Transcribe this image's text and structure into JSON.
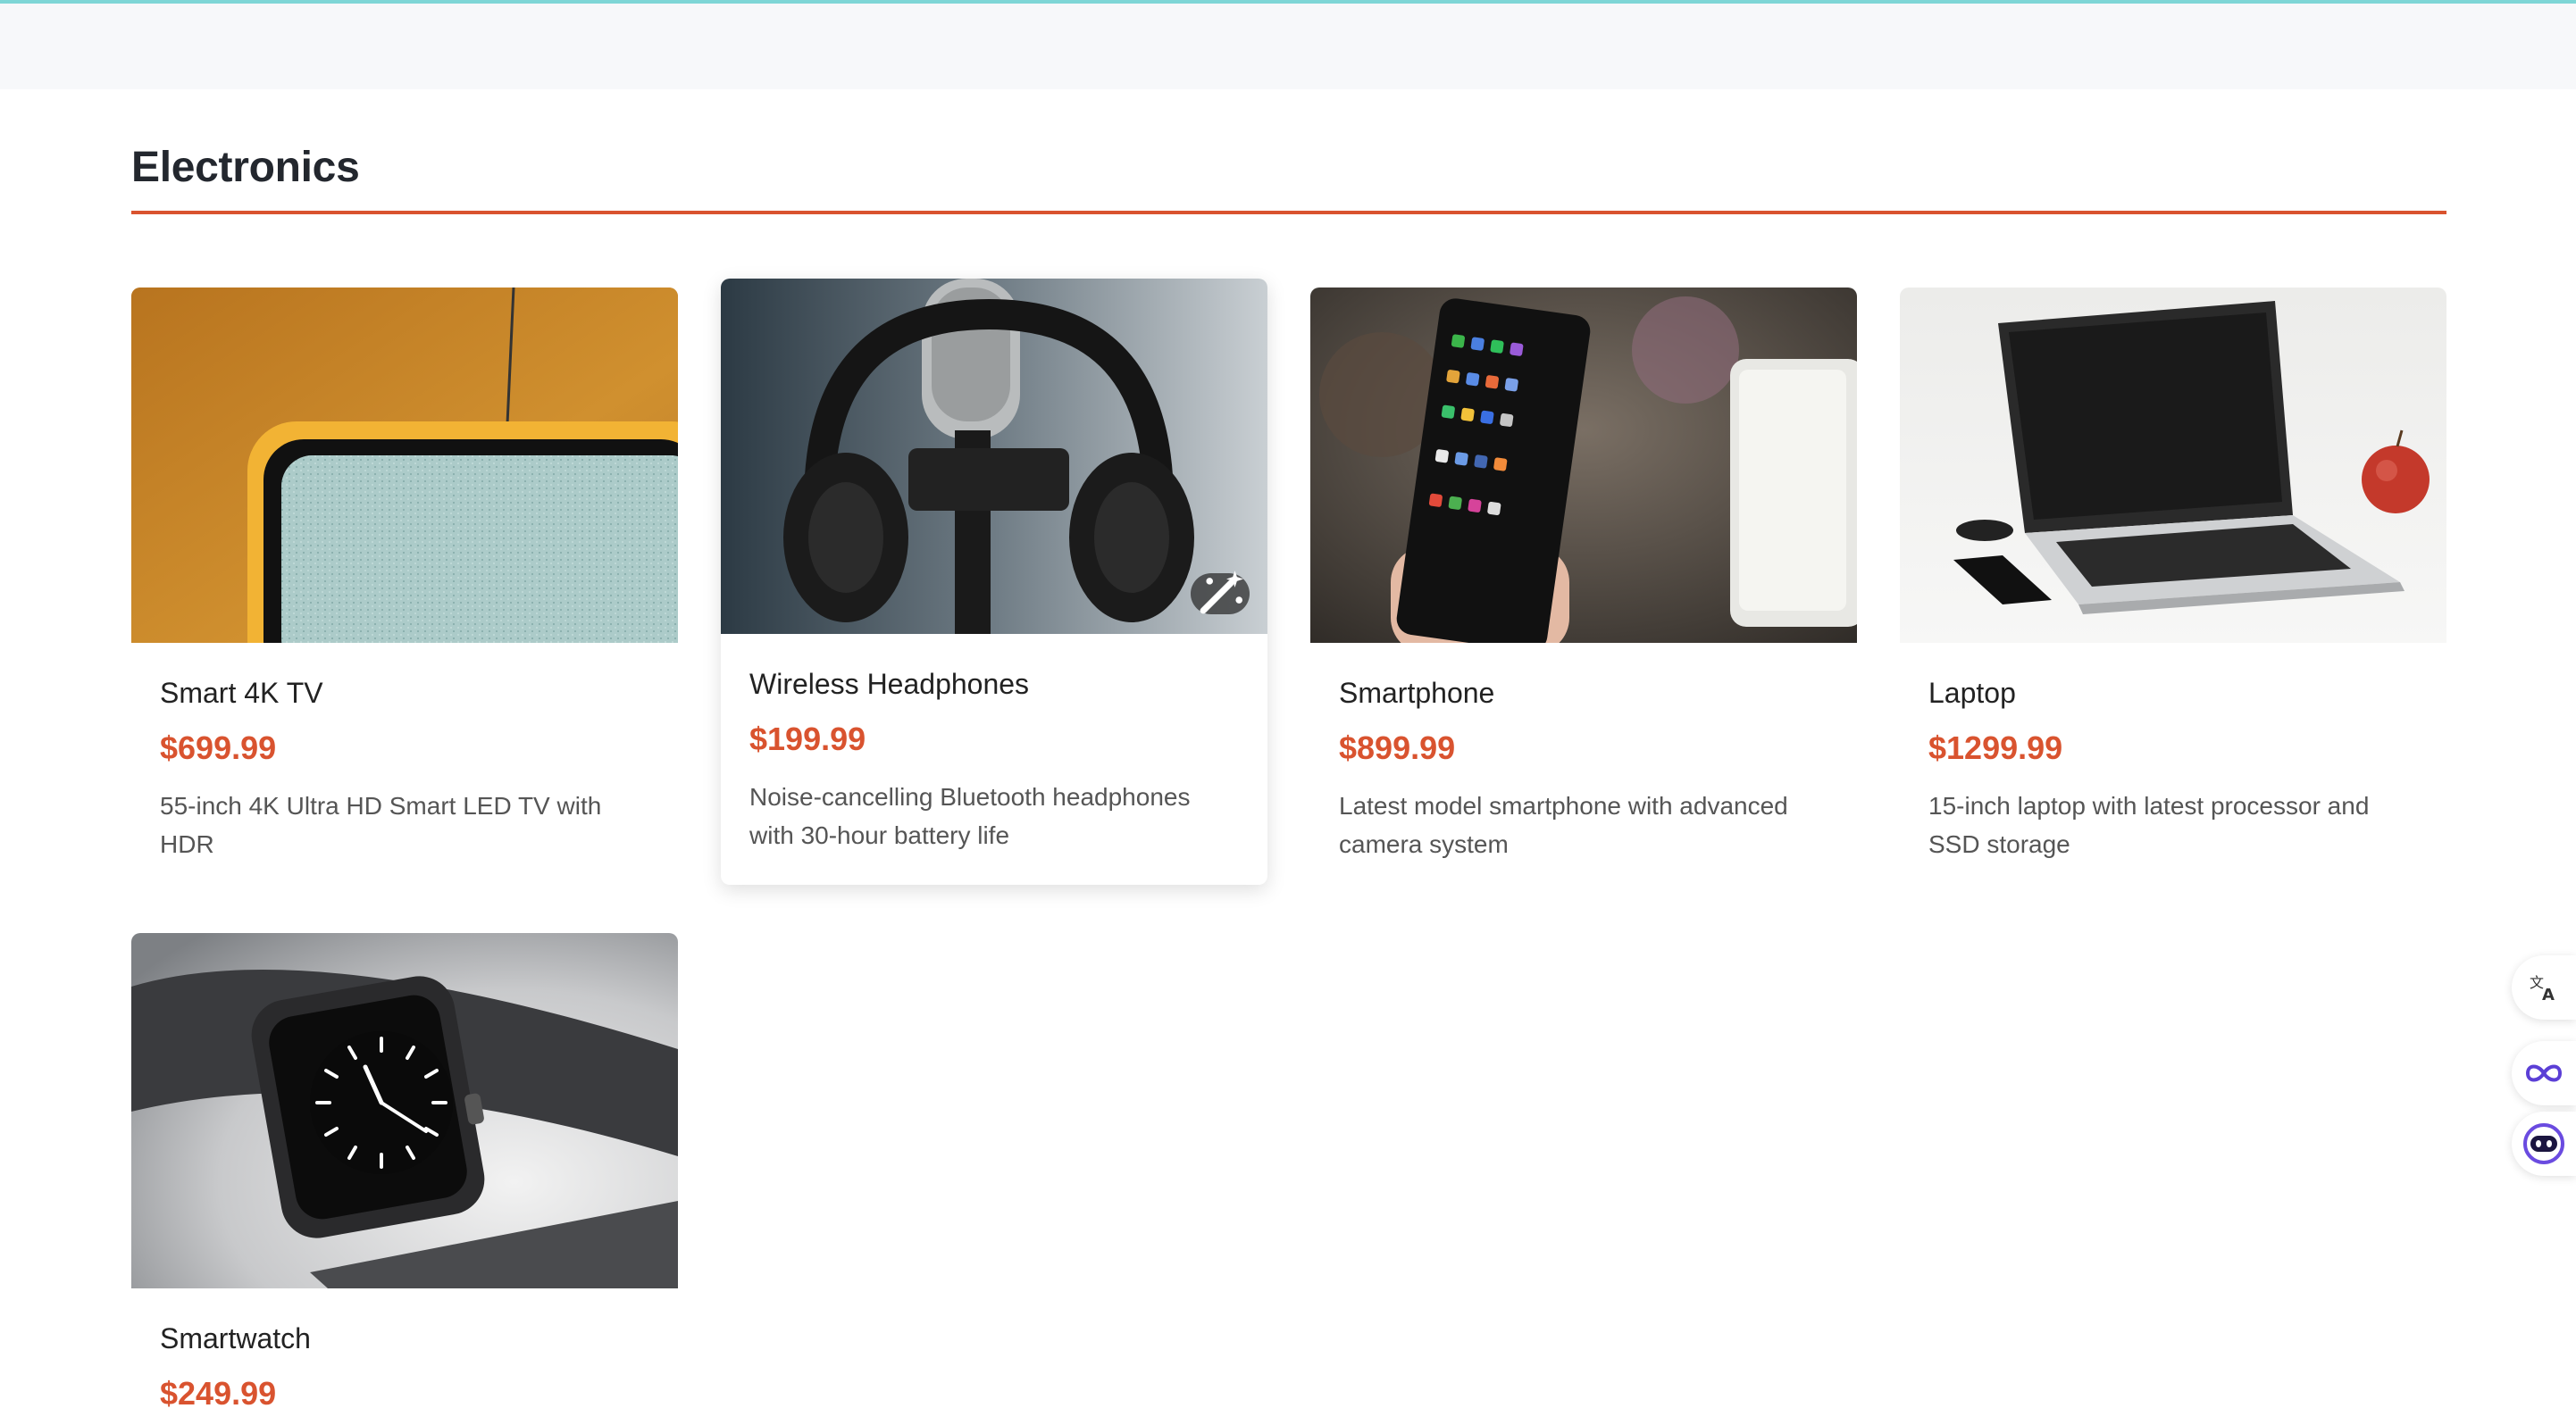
{
  "section": {
    "title": "Electronics"
  },
  "products": [
    {
      "name": "Smart 4K TV",
      "price": "$699.99",
      "description": "55-inch 4K Ultra HD Smart LED TV with HDR",
      "image_icon": "retro-tv-photo"
    },
    {
      "name": "Wireless Headphones",
      "price": "$199.99",
      "description": "Noise-cancelling Bluetooth headphones with 30-hour battery life",
      "image_icon": "headphones-photo"
    },
    {
      "name": "Smartphone",
      "price": "$899.99",
      "description": "Latest model smartphone with advanced camera system",
      "image_icon": "smartphone-photo"
    },
    {
      "name": "Laptop",
      "price": "$1299.99",
      "description": "15-inch laptop with latest processor and SSD storage",
      "image_icon": "laptop-photo"
    },
    {
      "name": "Smartwatch",
      "price": "$249.99",
      "description": "",
      "image_icon": "smartwatch-photo"
    }
  ],
  "side_widgets": [
    "translate-icon",
    "infinity-icon",
    "assistant-face-icon"
  ],
  "colors": {
    "accent": "#d9532f",
    "top_border": "#7ed6d6",
    "topbar_bg": "#f7f8fa"
  }
}
